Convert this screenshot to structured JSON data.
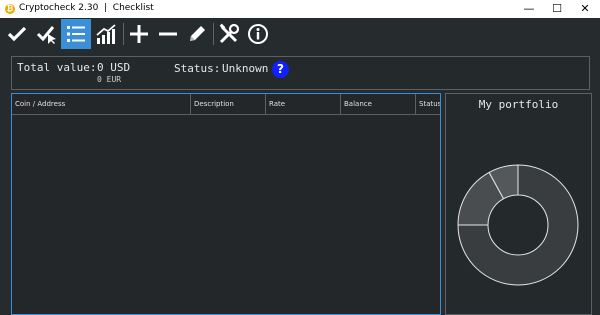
{
  "window": {
    "title": "Cryptocheck 2.30  |  Checklist",
    "minimize": "—",
    "maximize": "☐",
    "close": "✕"
  },
  "summary": {
    "total_label": "Total value:",
    "total_usd": "0 USD",
    "total_eur": "0 EUR",
    "status_label": "Status:",
    "status_value": "Unknown",
    "help": "?"
  },
  "table": {
    "columns": [
      "Coin / Address",
      "Description",
      "Rate",
      "Balance",
      "Status"
    ],
    "rows": []
  },
  "portfolio": {
    "title": "My portfolio",
    "slices": [
      {
        "value": 0.75,
        "color": "#3a3d3f"
      },
      {
        "value": 0.17,
        "color": "#4a4d50"
      },
      {
        "value": 0.08,
        "color": "#55585b"
      }
    ]
  },
  "colors": {
    "accent": "#3a8fd6",
    "background": "#262b2e",
    "help_badge": "#1020ff"
  }
}
